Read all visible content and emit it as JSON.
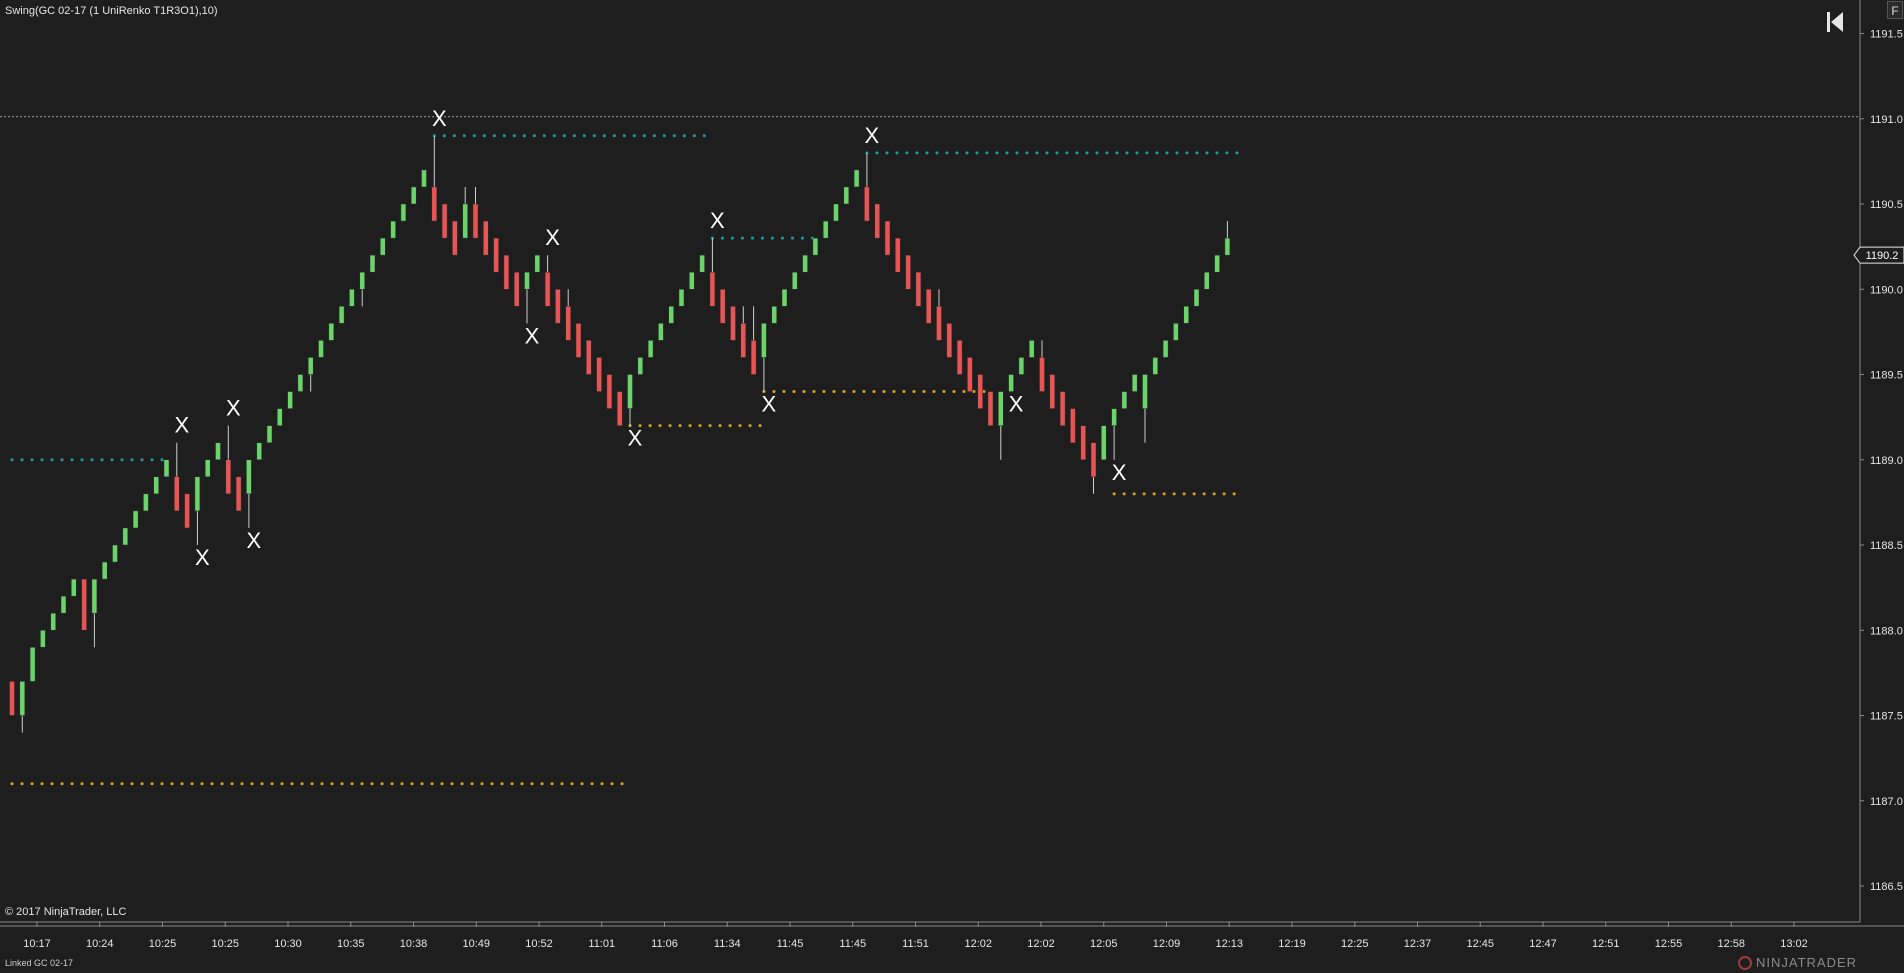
{
  "window": {
    "indicator_label": "Swing(GC 02-17 (1 UniRenko T1R3O1),10)",
    "copyright": "© 2017 NinjaTrader, LLC",
    "linked_label": "Linked GC 02-17",
    "brand": "NINJATRADER",
    "f_button": "F"
  },
  "colors": {
    "background": "#1e1e1e",
    "up_bar": "#6ad46a",
    "down_bar": "#e85454",
    "swing_high": "#1a9c9c",
    "swing_low": "#d9a21e",
    "marker": "#ffffff",
    "axis_text": "#e6e6e6"
  },
  "icons": {
    "rewind": "skip-to-start-icon",
    "brand_logo": "ninjatrader-logo-icon"
  },
  "chart_data": {
    "type": "candlestick",
    "instrument": "GC 02-17",
    "ylim": [
      1186.4,
      1191.7
    ],
    "y_ticks": [
      1186.5,
      1187.0,
      1187.5,
      1188.0,
      1188.5,
      1189.0,
      1189.5,
      1190.0,
      1190.5,
      1191.0,
      1191.5
    ],
    "x_ticks": [
      "10:17",
      "10:24",
      "10:25",
      "10:25",
      "10:30",
      "10:35",
      "10:38",
      "10:49",
      "10:52",
      "11:01",
      "11:06",
      "11:34",
      "11:45",
      "11:45",
      "11:51",
      "12:02",
      "12:02",
      "12:05",
      "12:09",
      "12:13",
      "12:19",
      "12:25",
      "12:37",
      "12:45",
      "12:47",
      "12:51",
      "12:55",
      "12:58",
      "13:02"
    ],
    "last_price": "1190.2",
    "last_price_value": 1190.2,
    "horizontal_line": 1191.0,
    "bars": [
      {
        "o": 1187.7,
        "c": 1187.5,
        "h": 1187.7,
        "l": 1187.5
      },
      {
        "o": 1187.5,
        "c": 1187.7,
        "h": 1187.7,
        "l": 1187.4
      },
      {
        "o": 1187.7,
        "c": 1187.9,
        "h": 1187.9,
        "l": 1187.7
      },
      {
        "o": 1187.9,
        "c": 1188.0,
        "h": 1188.0,
        "l": 1187.9
      },
      {
        "o": 1188.0,
        "c": 1188.1,
        "h": 1188.1,
        "l": 1188.0
      },
      {
        "o": 1188.1,
        "c": 1188.2,
        "h": 1188.2,
        "l": 1188.1
      },
      {
        "o": 1188.2,
        "c": 1188.3,
        "h": 1188.3,
        "l": 1188.2
      },
      {
        "o": 1188.3,
        "c": 1188.0,
        "h": 1188.3,
        "l": 1188.0
      },
      {
        "o": 1188.1,
        "c": 1188.3,
        "h": 1188.3,
        "l": 1187.9
      },
      {
        "o": 1188.3,
        "c": 1188.4,
        "h": 1188.4,
        "l": 1188.3
      },
      {
        "o": 1188.4,
        "c": 1188.5,
        "h": 1188.5,
        "l": 1188.4
      },
      {
        "o": 1188.5,
        "c": 1188.6,
        "h": 1188.6,
        "l": 1188.5
      },
      {
        "o": 1188.6,
        "c": 1188.7,
        "h": 1188.7,
        "l": 1188.6
      },
      {
        "o": 1188.7,
        "c": 1188.8,
        "h": 1188.8,
        "l": 1188.7
      },
      {
        "o": 1188.8,
        "c": 1188.9,
        "h": 1188.9,
        "l": 1188.8
      },
      {
        "o": 1188.9,
        "c": 1189.0,
        "h": 1189.0,
        "l": 1188.9
      },
      {
        "o": 1188.9,
        "c": 1188.7,
        "h": 1189.1,
        "l": 1188.7
      },
      {
        "o": 1188.8,
        "c": 1188.6,
        "h": 1188.8,
        "l": 1188.6
      },
      {
        "o": 1188.7,
        "c": 1188.9,
        "h": 1188.9,
        "l": 1188.5
      },
      {
        "o": 1188.9,
        "c": 1189.0,
        "h": 1189.0,
        "l": 1188.9
      },
      {
        "o": 1189.0,
        "c": 1189.1,
        "h": 1189.1,
        "l": 1189.0
      },
      {
        "o": 1189.0,
        "c": 1188.8,
        "h": 1189.2,
        "l": 1188.8
      },
      {
        "o": 1188.9,
        "c": 1188.7,
        "h": 1188.9,
        "l": 1188.7
      },
      {
        "o": 1188.8,
        "c": 1189.0,
        "h": 1189.0,
        "l": 1188.6
      },
      {
        "o": 1189.0,
        "c": 1189.1,
        "h": 1189.1,
        "l": 1189.0
      },
      {
        "o": 1189.1,
        "c": 1189.2,
        "h": 1189.2,
        "l": 1189.1
      },
      {
        "o": 1189.2,
        "c": 1189.3,
        "h": 1189.3,
        "l": 1189.2
      },
      {
        "o": 1189.3,
        "c": 1189.4,
        "h": 1189.4,
        "l": 1189.3
      },
      {
        "o": 1189.4,
        "c": 1189.5,
        "h": 1189.5,
        "l": 1189.4
      },
      {
        "o": 1189.5,
        "c": 1189.6,
        "h": 1189.6,
        "l": 1189.4
      },
      {
        "o": 1189.6,
        "c": 1189.7,
        "h": 1189.7,
        "l": 1189.6
      },
      {
        "o": 1189.7,
        "c": 1189.8,
        "h": 1189.8,
        "l": 1189.7
      },
      {
        "o": 1189.8,
        "c": 1189.9,
        "h": 1189.9,
        "l": 1189.8
      },
      {
        "o": 1189.9,
        "c": 1190.0,
        "h": 1190.0,
        "l": 1189.9
      },
      {
        "o": 1190.0,
        "c": 1190.1,
        "h": 1190.1,
        "l": 1189.9
      },
      {
        "o": 1190.1,
        "c": 1190.2,
        "h": 1190.2,
        "l": 1190.1
      },
      {
        "o": 1190.2,
        "c": 1190.3,
        "h": 1190.3,
        "l": 1190.2
      },
      {
        "o": 1190.3,
        "c": 1190.4,
        "h": 1190.4,
        "l": 1190.3
      },
      {
        "o": 1190.4,
        "c": 1190.5,
        "h": 1190.5,
        "l": 1190.4
      },
      {
        "o": 1190.5,
        "c": 1190.6,
        "h": 1190.6,
        "l": 1190.5
      },
      {
        "o": 1190.6,
        "c": 1190.7,
        "h": 1190.7,
        "l": 1190.6
      },
      {
        "o": 1190.6,
        "c": 1190.4,
        "h": 1190.9,
        "l": 1190.4
      },
      {
        "o": 1190.5,
        "c": 1190.3,
        "h": 1190.5,
        "l": 1190.3
      },
      {
        "o": 1190.4,
        "c": 1190.2,
        "h": 1190.4,
        "l": 1190.2
      },
      {
        "o": 1190.3,
        "c": 1190.5,
        "h": 1190.6,
        "l": 1190.3
      },
      {
        "o": 1190.5,
        "c": 1190.3,
        "h": 1190.6,
        "l": 1190.3
      },
      {
        "o": 1190.4,
        "c": 1190.2,
        "h": 1190.4,
        "l": 1190.2
      },
      {
        "o": 1190.3,
        "c": 1190.1,
        "h": 1190.3,
        "l": 1190.1
      },
      {
        "o": 1190.2,
        "c": 1190.0,
        "h": 1190.2,
        "l": 1190.0
      },
      {
        "o": 1190.1,
        "c": 1189.9,
        "h": 1190.1,
        "l": 1189.9
      },
      {
        "o": 1190.0,
        "c": 1190.1,
        "h": 1190.1,
        "l": 1189.8
      },
      {
        "o": 1190.1,
        "c": 1190.2,
        "h": 1190.2,
        "l": 1190.1
      },
      {
        "o": 1190.1,
        "c": 1189.9,
        "h": 1190.2,
        "l": 1189.9
      },
      {
        "o": 1190.0,
        "c": 1189.8,
        "h": 1190.0,
        "l": 1189.8
      },
      {
        "o": 1189.9,
        "c": 1189.7,
        "h": 1190.0,
        "l": 1189.7
      },
      {
        "o": 1189.8,
        "c": 1189.6,
        "h": 1189.8,
        "l": 1189.6
      },
      {
        "o": 1189.7,
        "c": 1189.5,
        "h": 1189.7,
        "l": 1189.5
      },
      {
        "o": 1189.6,
        "c": 1189.4,
        "h": 1189.6,
        "l": 1189.4
      },
      {
        "o": 1189.5,
        "c": 1189.3,
        "h": 1189.5,
        "l": 1189.3
      },
      {
        "o": 1189.4,
        "c": 1189.2,
        "h": 1189.4,
        "l": 1189.2
      },
      {
        "o": 1189.3,
        "c": 1189.5,
        "h": 1189.5,
        "l": 1189.2
      },
      {
        "o": 1189.5,
        "c": 1189.6,
        "h": 1189.6,
        "l": 1189.5
      },
      {
        "o": 1189.6,
        "c": 1189.7,
        "h": 1189.7,
        "l": 1189.6
      },
      {
        "o": 1189.7,
        "c": 1189.8,
        "h": 1189.8,
        "l": 1189.7
      },
      {
        "o": 1189.8,
        "c": 1189.9,
        "h": 1189.9,
        "l": 1189.8
      },
      {
        "o": 1189.9,
        "c": 1190.0,
        "h": 1190.0,
        "l": 1189.9
      },
      {
        "o": 1190.0,
        "c": 1190.1,
        "h": 1190.1,
        "l": 1190.0
      },
      {
        "o": 1190.1,
        "c": 1190.2,
        "h": 1190.2,
        "l": 1190.1
      },
      {
        "o": 1190.1,
        "c": 1189.9,
        "h": 1190.3,
        "l": 1189.9
      },
      {
        "o": 1190.0,
        "c": 1189.8,
        "h": 1190.0,
        "l": 1189.8
      },
      {
        "o": 1189.9,
        "c": 1189.7,
        "h": 1189.9,
        "l": 1189.7
      },
      {
        "o": 1189.8,
        "c": 1189.6,
        "h": 1189.9,
        "l": 1189.6
      },
      {
        "o": 1189.7,
        "c": 1189.5,
        "h": 1189.9,
        "l": 1189.5
      },
      {
        "o": 1189.6,
        "c": 1189.8,
        "h": 1189.8,
        "l": 1189.4
      },
      {
        "o": 1189.8,
        "c": 1189.9,
        "h": 1189.9,
        "l": 1189.8
      },
      {
        "o": 1189.9,
        "c": 1190.0,
        "h": 1190.0,
        "l": 1189.9
      },
      {
        "o": 1190.0,
        "c": 1190.1,
        "h": 1190.1,
        "l": 1190.0
      },
      {
        "o": 1190.1,
        "c": 1190.2,
        "h": 1190.2,
        "l": 1190.1
      },
      {
        "o": 1190.2,
        "c": 1190.3,
        "h": 1190.3,
        "l": 1190.2
      },
      {
        "o": 1190.3,
        "c": 1190.4,
        "h": 1190.4,
        "l": 1190.3
      },
      {
        "o": 1190.4,
        "c": 1190.5,
        "h": 1190.5,
        "l": 1190.4
      },
      {
        "o": 1190.5,
        "c": 1190.6,
        "h": 1190.6,
        "l": 1190.5
      },
      {
        "o": 1190.6,
        "c": 1190.7,
        "h": 1190.7,
        "l": 1190.6
      },
      {
        "o": 1190.6,
        "c": 1190.4,
        "h": 1190.8,
        "l": 1190.4
      },
      {
        "o": 1190.5,
        "c": 1190.3,
        "h": 1190.5,
        "l": 1190.3
      },
      {
        "o": 1190.4,
        "c": 1190.2,
        "h": 1190.4,
        "l": 1190.2
      },
      {
        "o": 1190.3,
        "c": 1190.1,
        "h": 1190.3,
        "l": 1190.1
      },
      {
        "o": 1190.2,
        "c": 1190.0,
        "h": 1190.2,
        "l": 1190.0
      },
      {
        "o": 1190.1,
        "c": 1189.9,
        "h": 1190.1,
        "l": 1189.9
      },
      {
        "o": 1190.0,
        "c": 1189.8,
        "h": 1190.0,
        "l": 1189.8
      },
      {
        "o": 1189.9,
        "c": 1189.7,
        "h": 1190.0,
        "l": 1189.7
      },
      {
        "o": 1189.8,
        "c": 1189.6,
        "h": 1189.8,
        "l": 1189.6
      },
      {
        "o": 1189.7,
        "c": 1189.5,
        "h": 1189.7,
        "l": 1189.5
      },
      {
        "o": 1189.6,
        "c": 1189.4,
        "h": 1189.6,
        "l": 1189.4
      },
      {
        "o": 1189.5,
        "c": 1189.3,
        "h": 1189.5,
        "l": 1189.3
      },
      {
        "o": 1189.4,
        "c": 1189.2,
        "h": 1189.4,
        "l": 1189.2
      },
      {
        "o": 1189.2,
        "c": 1189.4,
        "h": 1189.4,
        "l": 1189.0
      },
      {
        "o": 1189.4,
        "c": 1189.5,
        "h": 1189.5,
        "l": 1189.4
      },
      {
        "o": 1189.5,
        "c": 1189.6,
        "h": 1189.6,
        "l": 1189.5
      },
      {
        "o": 1189.6,
        "c": 1189.7,
        "h": 1189.7,
        "l": 1189.6
      },
      {
        "o": 1189.6,
        "c": 1189.4,
        "h": 1189.7,
        "l": 1189.4
      },
      {
        "o": 1189.5,
        "c": 1189.3,
        "h": 1189.5,
        "l": 1189.3
      },
      {
        "o": 1189.4,
        "c": 1189.2,
        "h": 1189.4,
        "l": 1189.2
      },
      {
        "o": 1189.3,
        "c": 1189.1,
        "h": 1189.3,
        "l": 1189.1
      },
      {
        "o": 1189.2,
        "c": 1189.0,
        "h": 1189.2,
        "l": 1189.0
      },
      {
        "o": 1189.1,
        "c": 1188.9,
        "h": 1189.1,
        "l": 1188.8
      },
      {
        "o": 1189.0,
        "c": 1189.2,
        "h": 1189.2,
        "l": 1189.0
      },
      {
        "o": 1189.2,
        "c": 1189.3,
        "h": 1189.3,
        "l": 1189.0
      },
      {
        "o": 1189.3,
        "c": 1189.4,
        "h": 1189.4,
        "l": 1189.3
      },
      {
        "o": 1189.4,
        "c": 1189.5,
        "h": 1189.5,
        "l": 1189.4
      },
      {
        "o": 1189.3,
        "c": 1189.5,
        "h": 1189.5,
        "l": 1189.1
      },
      {
        "o": 1189.5,
        "c": 1189.6,
        "h": 1189.6,
        "l": 1189.5
      },
      {
        "o": 1189.6,
        "c": 1189.7,
        "h": 1189.7,
        "l": 1189.6
      },
      {
        "o": 1189.7,
        "c": 1189.8,
        "h": 1189.8,
        "l": 1189.7
      },
      {
        "o": 1189.8,
        "c": 1189.9,
        "h": 1189.9,
        "l": 1189.8
      },
      {
        "o": 1189.9,
        "c": 1190.0,
        "h": 1190.0,
        "l": 1189.9
      },
      {
        "o": 1190.0,
        "c": 1190.1,
        "h": 1190.1,
        "l": 1190.0
      },
      {
        "o": 1190.1,
        "c": 1190.2,
        "h": 1190.2,
        "l": 1190.1
      },
      {
        "o": 1190.2,
        "c": 1190.3,
        "h": 1190.4,
        "l": 1190.2
      }
    ],
    "swing_markers": [
      {
        "bar": 16,
        "type": "high"
      },
      {
        "bar": 18,
        "type": "low"
      },
      {
        "bar": 21,
        "type": "high"
      },
      {
        "bar": 23,
        "type": "low"
      },
      {
        "bar": 41,
        "type": "high"
      },
      {
        "bar": 50,
        "type": "low"
      },
      {
        "bar": 52,
        "type": "high"
      },
      {
        "bar": 60,
        "type": "low"
      },
      {
        "bar": 68,
        "type": "high"
      },
      {
        "bar": 73,
        "type": "low"
      },
      {
        "bar": 83,
        "type": "high"
      },
      {
        "bar": 97,
        "type": "low"
      },
      {
        "bar": 107,
        "type": "low"
      }
    ],
    "swing_lines": [
      {
        "type": "high",
        "price": 1189.0,
        "from_bar": 0,
        "to_bar": 15
      },
      {
        "type": "low",
        "price": 1187.1,
        "from_bar": 0,
        "to_bar": 60
      },
      {
        "type": "high",
        "price": 1190.9,
        "from_bar": 41,
        "to_bar": 68
      },
      {
        "type": "low",
        "price": 1189.2,
        "from_bar": 60,
        "to_bar": 73
      },
      {
        "type": "high",
        "price": 1190.3,
        "from_bar": 68,
        "to_bar": 78
      },
      {
        "type": "low",
        "price": 1189.4,
        "from_bar": 73,
        "to_bar": 95
      },
      {
        "type": "high",
        "price": 1190.8,
        "from_bar": 83,
        "to_bar": 119
      },
      {
        "type": "low",
        "price": 1188.8,
        "from_bar": 107,
        "to_bar": 119
      }
    ],
    "marker_label": "X"
  }
}
